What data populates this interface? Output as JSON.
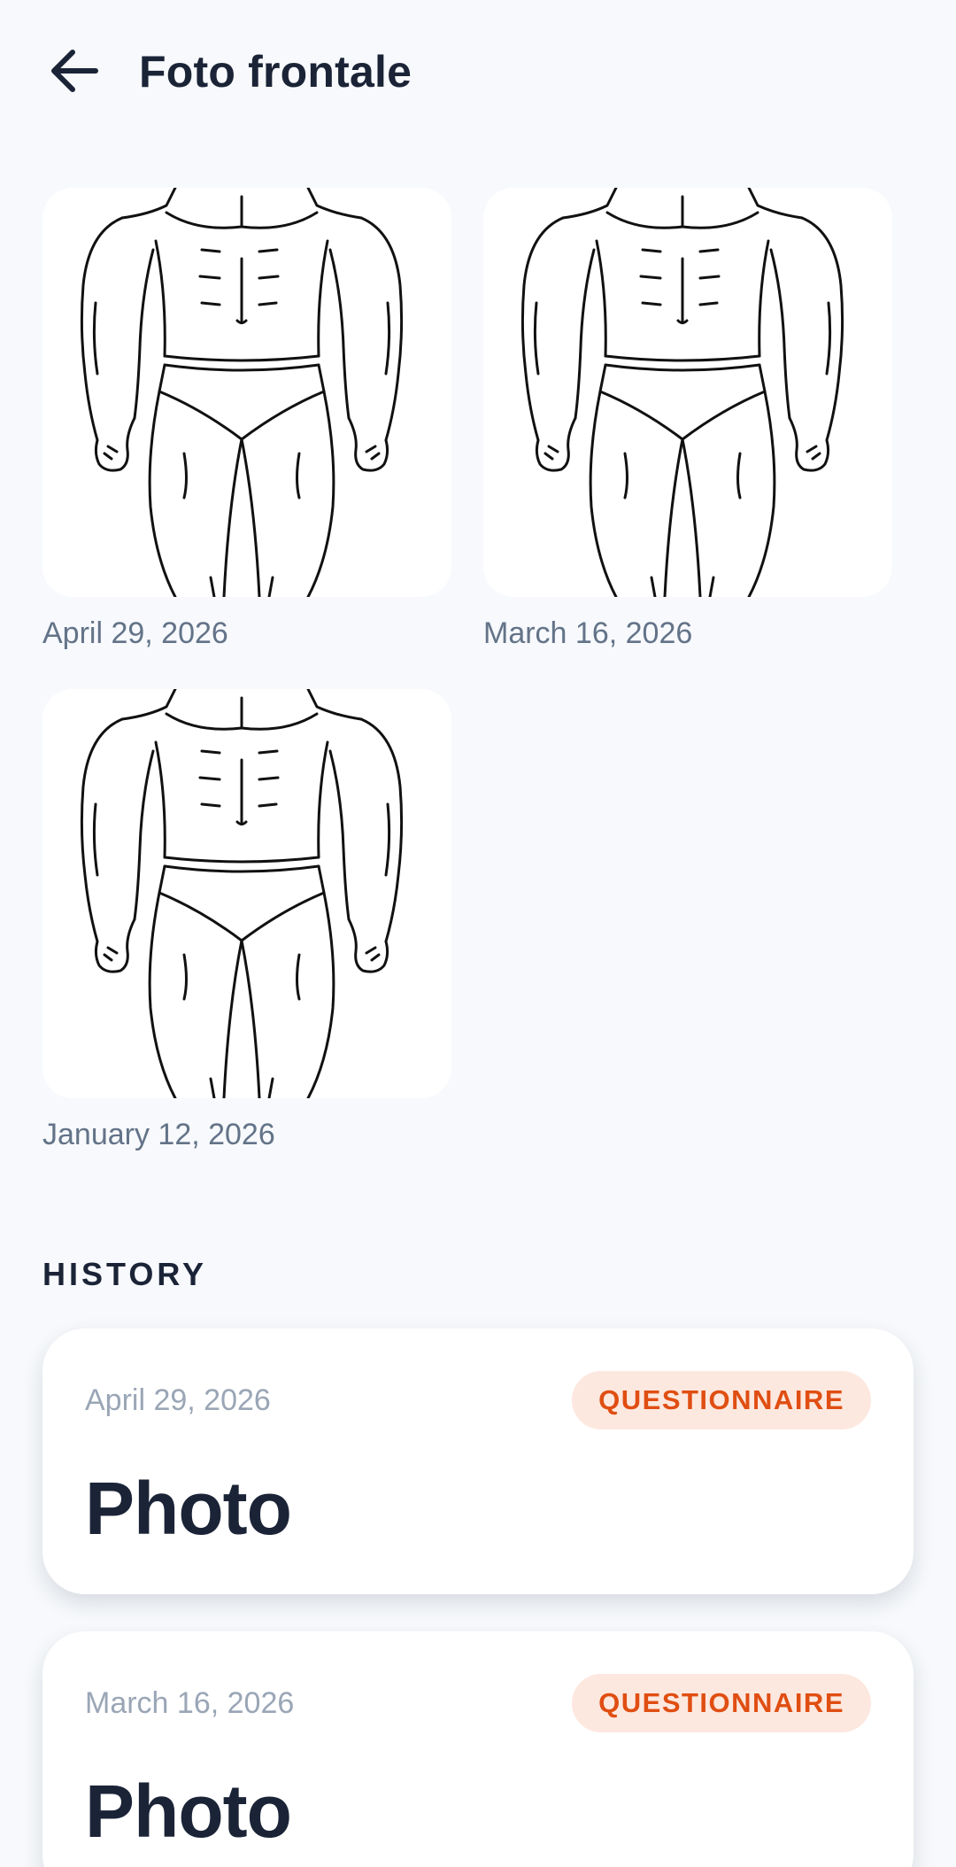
{
  "header": {
    "title": "Foto frontale",
    "back_icon": "arrow-left-icon"
  },
  "photos": [
    {
      "date": "April 29, 2026",
      "image": "front-body-photo"
    },
    {
      "date": "March 16, 2026",
      "image": "front-body-photo"
    },
    {
      "date": "January 12, 2026",
      "image": "front-body-photo"
    }
  ],
  "history": {
    "title": "HISTORY",
    "items": [
      {
        "date": "April 29, 2026",
        "badge": "QUESTIONNAIRE",
        "title": "Photo"
      },
      {
        "date": "March 16, 2026",
        "badge": "QUESTIONNAIRE",
        "title": "Photo"
      }
    ]
  },
  "colors": {
    "background": "#f7f9fc",
    "text": "#1b2437",
    "muted": "#637388",
    "badge_bg": "#fde8df",
    "badge_text": "#e04e12"
  }
}
